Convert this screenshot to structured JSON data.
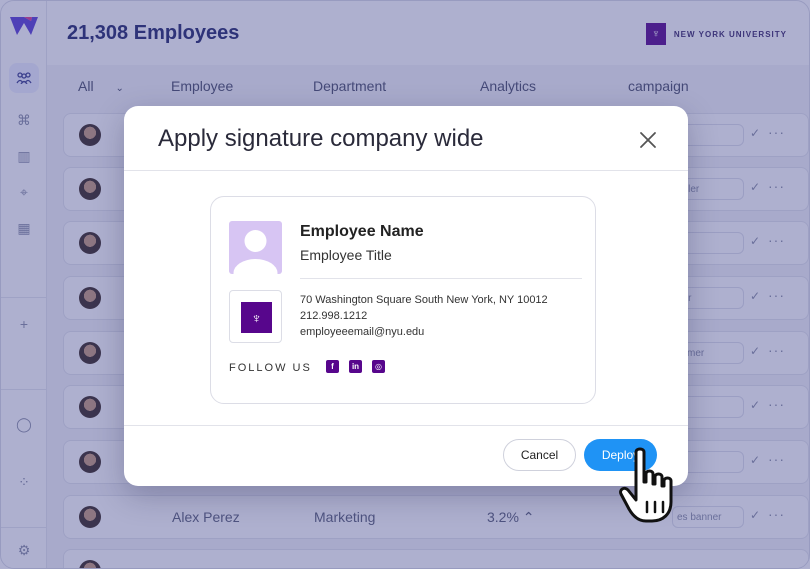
{
  "header": {
    "title": "21,308 Employees",
    "brand": "NEW YORK UNIVERSITY"
  },
  "columns": [
    "All",
    "Employee",
    "Department",
    "Analytics",
    "campaign"
  ],
  "rows": [
    {
      "name": "",
      "department": "",
      "analytics": "",
      "campaign": "ds"
    },
    {
      "name": "",
      "department": "",
      "analytics": "",
      "campaign": "duler"
    },
    {
      "name": "",
      "department": "",
      "analytics": "",
      "campaign": "r"
    },
    {
      "name": "",
      "department": "",
      "analytics": "",
      "campaign": "ner"
    },
    {
      "name": "",
      "department": "",
      "analytics": "",
      "campaign": "laimer"
    },
    {
      "name": "",
      "department": "",
      "analytics": "",
      "campaign": "o"
    },
    {
      "name": "",
      "department": "",
      "analytics": "",
      "campaign": "e"
    },
    {
      "name": "Alex Perez",
      "department": "Marketing",
      "analytics": "3.2% ⌃",
      "campaign": "es banner"
    }
  ],
  "modal": {
    "title": "Apply signature company wide",
    "signature": {
      "name": "Employee Name",
      "job_title": "Employee Title",
      "address": "70 Washington Square South New York, NY 10012",
      "phone": "212.998.1212",
      "email": "employeeemail@nyu.edu",
      "follow_label": "FOLLOW US",
      "social": [
        "f",
        "in",
        "◎"
      ]
    },
    "cancel_label": "Cancel",
    "deploy_label": "Deploy"
  },
  "colors": {
    "overlay": "#3e428c",
    "brand_purple": "#57068c",
    "deploy_blue": "#1f93f5",
    "title_navy": "#23286b"
  }
}
